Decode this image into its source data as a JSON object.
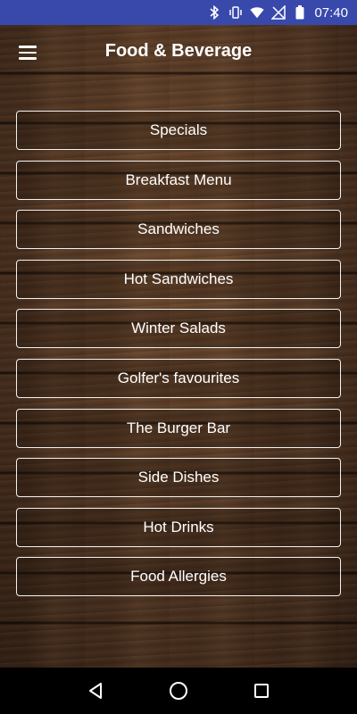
{
  "status_bar": {
    "time": "07:40",
    "icons": [
      "bluetooth-icon",
      "vibrate-icon",
      "wifi-icon",
      "signal-off-icon",
      "battery-icon"
    ]
  },
  "app_bar": {
    "title": "Food & Beverage",
    "menu_icon": "hamburger-menu-icon"
  },
  "menu": {
    "items": [
      {
        "label": "Specials"
      },
      {
        "label": "Breakfast Menu"
      },
      {
        "label": "Sandwiches"
      },
      {
        "label": "Hot Sandwiches"
      },
      {
        "label": "Winter Salads"
      },
      {
        "label": "Golfer's favourites"
      },
      {
        "label": "The Burger Bar"
      },
      {
        "label": "Side Dishes"
      },
      {
        "label": "Hot Drinks"
      },
      {
        "label": "Food Allergies"
      }
    ]
  },
  "nav_bar": {
    "icons": [
      "back-icon",
      "home-icon",
      "recents-icon"
    ]
  },
  "colors": {
    "status_bar": "#3949ab",
    "text": "#ffffff",
    "button_border": "#f2f2f2",
    "wood": "#4d3220"
  }
}
